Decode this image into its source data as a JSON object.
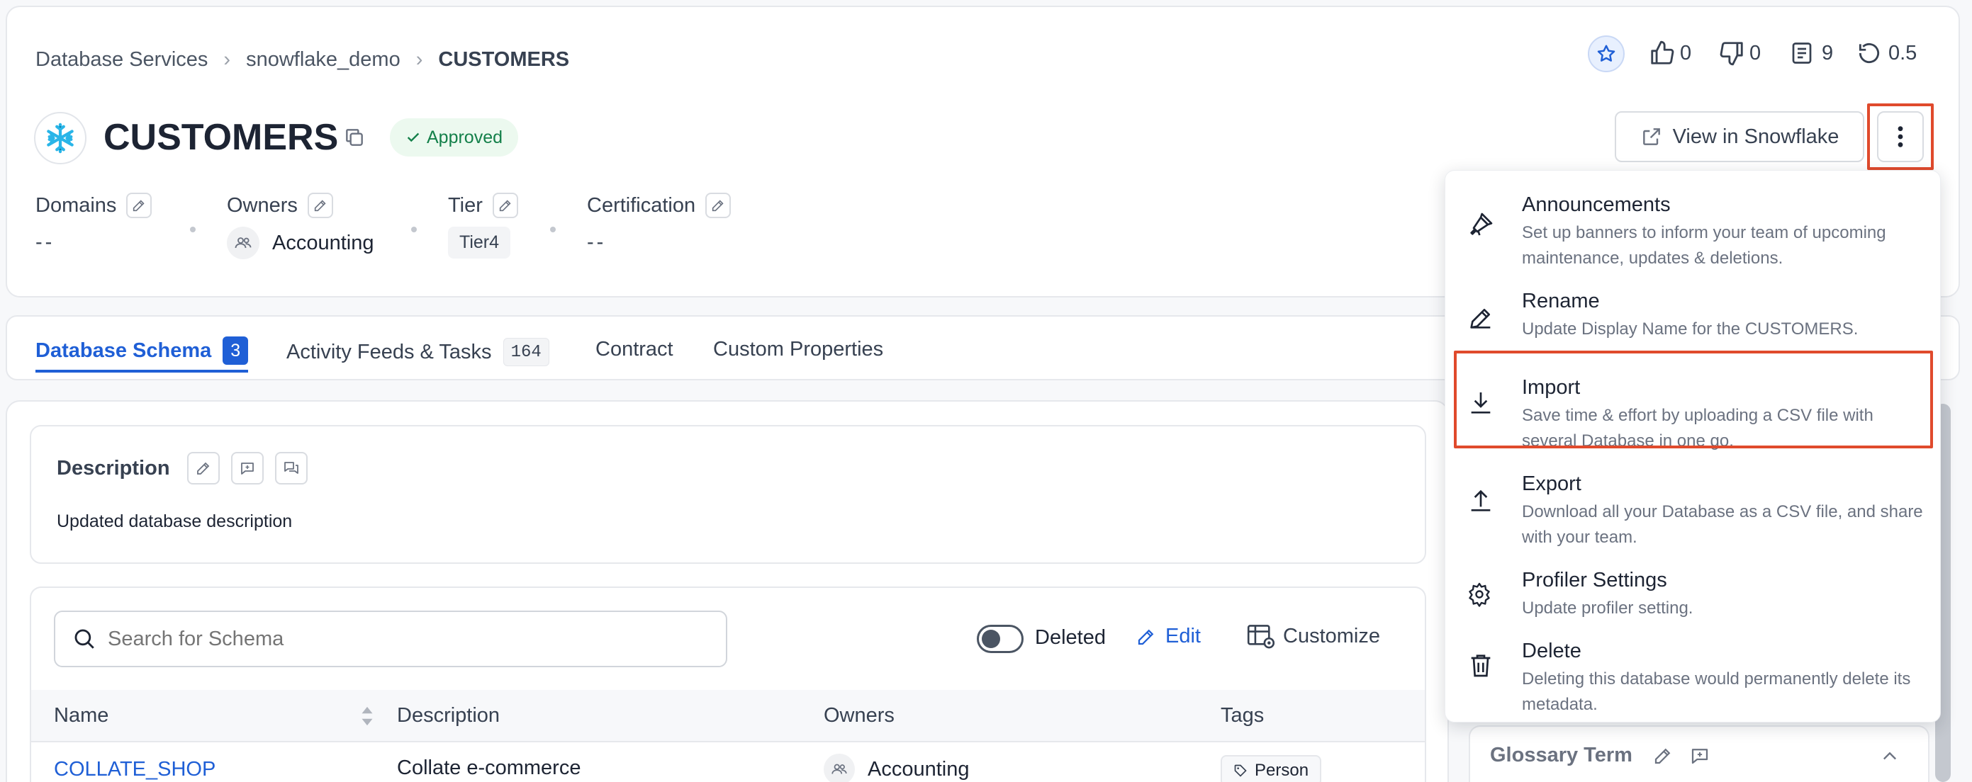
{
  "breadcrumb": [
    "Database Services",
    "snowflake_demo",
    "CUSTOMERS"
  ],
  "header_stats": {
    "likes": "0",
    "dislikes": "0",
    "docs": "9",
    "version": "0.5"
  },
  "title": "CUSTOMERS",
  "status_badge": "Approved",
  "view_button": "View in Snowflake",
  "meta": {
    "domains_label": "Domains",
    "domains_value": "--",
    "owners_label": "Owners",
    "owners_value": "Accounting",
    "tier_label": "Tier",
    "tier_value": "Tier4",
    "certification_label": "Certification",
    "certification_value": "--"
  },
  "tabs": [
    {
      "label": "Database Schema",
      "count": "3"
    },
    {
      "label": "Activity Feeds & Tasks",
      "count": "164"
    },
    {
      "label": "Contract"
    },
    {
      "label": "Custom Properties"
    }
  ],
  "description": {
    "label": "Description",
    "text": "Updated database description"
  },
  "schema_table": {
    "search_placeholder": "Search for Schema",
    "deleted_label": "Deleted",
    "edit_label": "Edit",
    "customize_label": "Customize",
    "columns": [
      "Name",
      "Description",
      "Owners",
      "Tags"
    ],
    "rows": [
      {
        "name": "COLLATE_SHOP",
        "description": "Collate e-commerce",
        "owner": "Accounting",
        "tag": "Person"
      }
    ]
  },
  "glossary_term_label": "Glossary Term",
  "menu": [
    {
      "title": "Announcements",
      "desc": "Set up banners to inform your team of upcoming maintenance, updates & deletions.",
      "icon": "megaphone-icon"
    },
    {
      "title": "Rename",
      "desc": "Update Display Name for the CUSTOMERS.",
      "icon": "pen-icon"
    },
    {
      "title": "Import",
      "desc": "Save time & effort by uploading a CSV file with several Database in one go.",
      "icon": "download-icon"
    },
    {
      "title": "Export",
      "desc": "Download all your Database as a CSV file, and share with your team.",
      "icon": "upload-icon"
    },
    {
      "title": "Profiler Settings",
      "desc": "Update profiler setting.",
      "icon": "gear-icon"
    },
    {
      "title": "Delete",
      "desc": "Deleting this database would permanently delete its metadata.",
      "icon": "trash-icon"
    }
  ],
  "colors": {
    "accent": "#1f5fd6",
    "highlight": "#e04a2c",
    "approved_bg": "#ecf9ef",
    "approved_text": "#14804a"
  }
}
